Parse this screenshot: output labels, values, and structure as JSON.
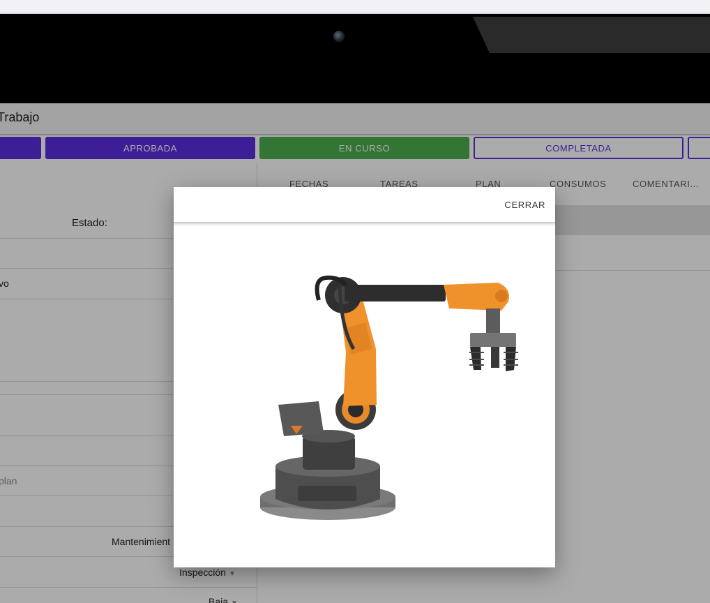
{
  "app": {
    "title": "Trabajo"
  },
  "status_buttons": [
    {
      "label": ""
    },
    {
      "label": "APROBADA"
    },
    {
      "label": "EN CURSO"
    },
    {
      "label": "COMPLETADA"
    },
    {
      "label": ""
    }
  ],
  "tabs": [
    {
      "label": "FECHAS"
    },
    {
      "label": "TAREAS"
    },
    {
      "label": "PLAN"
    },
    {
      "label": "CONSUMOS"
    },
    {
      "label": "COMENTARI..."
    }
  ],
  "form": {
    "estado_label": "Estado:",
    "field_vo": "vo",
    "field_plan": "plan",
    "mantenimiento": "Mantenimient",
    "inspeccion": "Inspección",
    "baja": "Baja"
  },
  "dialog": {
    "close_label": "CERRAR",
    "image_icon": "robot-arm-image"
  },
  "colors": {
    "primary": "#5b2ee0",
    "success": "#4caf50",
    "robot_orange": "#f0922b",
    "robot_gray": "#4a4a4a"
  }
}
